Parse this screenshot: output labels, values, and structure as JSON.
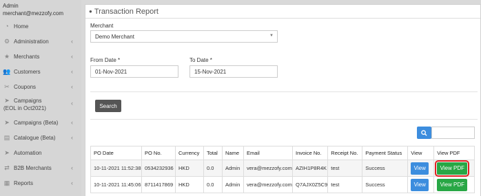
{
  "sidebar": {
    "user_role": "Admin",
    "user_email": "merchant@mezzofy.com",
    "items": [
      {
        "label": "Home",
        "icon": "dashboard-icon",
        "chevron": ""
      },
      {
        "label": "Administration",
        "icon": "gear-icon",
        "chevron": "‹"
      },
      {
        "label": "Merchants",
        "icon": "star-icon",
        "chevron": "‹"
      },
      {
        "label": "Customers",
        "icon": "users-icon",
        "chevron": "‹"
      },
      {
        "label": "Coupons",
        "icon": "tag-icon",
        "chevron": "‹"
      },
      {
        "label": "Campaigns",
        "label2": "(EOL in Oct2021)",
        "icon": "paper-plane-icon",
        "chevron": "‹"
      },
      {
        "label": "Campaigns (Beta)",
        "icon": "paper-plane-icon",
        "chevron": "‹"
      },
      {
        "label": "Catalogue (Beta)",
        "icon": "book-icon",
        "chevron": "‹"
      },
      {
        "label": "Automation",
        "icon": "paper-plane-icon",
        "chevron": ""
      },
      {
        "label": "B2B Merchants",
        "icon": "exchange-icon",
        "chevron": "‹"
      },
      {
        "label": "Reports",
        "icon": "report-icon",
        "chevron": "‹"
      }
    ]
  },
  "panel": {
    "title": "Transaction Report",
    "merchant_label": "Merchant",
    "merchant_value": "Demo Merchant",
    "from_label": "From Date *",
    "from_value": "01-Nov-2021",
    "to_label": "To Date *",
    "to_value": "15-Nov-2021",
    "search_button": "Search"
  },
  "table": {
    "headers": [
      "PO Date",
      "PO No.",
      "Currency",
      "Total",
      "Name",
      "Email",
      "Invoice No.",
      "Receipt No.",
      "Payment Status",
      "View",
      "View PDF"
    ],
    "rows": [
      {
        "po_date": "10-11-2021 11:52:38",
        "po_no": "0534232936",
        "currency": "HKD",
        "total": "0.0",
        "name": "Admin",
        "email": "vera@mezzofy.com",
        "invoice": "AZIH1P8R4K",
        "receipt": "test",
        "status": "Success",
        "view": "View",
        "pdf": "View PDF"
      },
      {
        "po_date": "10-11-2021 11:45:06",
        "po_no": "8711417869",
        "currency": "HKD",
        "total": "0.0",
        "name": "Admin",
        "email": "vera@mezzofy.com",
        "invoice": "Q7AJX0Z5C9",
        "receipt": "test",
        "status": "Success",
        "view": "View",
        "pdf": "View PDF"
      }
    ]
  },
  "colors": {
    "primary": "#3c8dde",
    "success": "#28a745",
    "highlight": "#e02020",
    "dark_button": "#555555"
  }
}
